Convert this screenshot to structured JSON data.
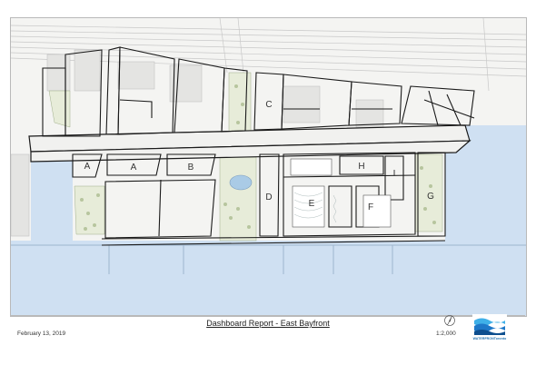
{
  "report": {
    "title": "Dashboard Report - East Bayfront",
    "date": "February 13, 2019",
    "scale": "1:2,000"
  },
  "logo": {
    "text": "WATERFRONToronto",
    "brand_color": "#1e78c8"
  },
  "map": {
    "water_color": "#cfe0f2",
    "park_color": "#e7ecd9",
    "parcel_labels": [
      "A",
      "A",
      "B",
      "C",
      "D",
      "E",
      "F",
      "G",
      "H",
      "I"
    ]
  },
  "icons": [
    "north-arrow-icon",
    "waterfront-toronto-logo"
  ]
}
